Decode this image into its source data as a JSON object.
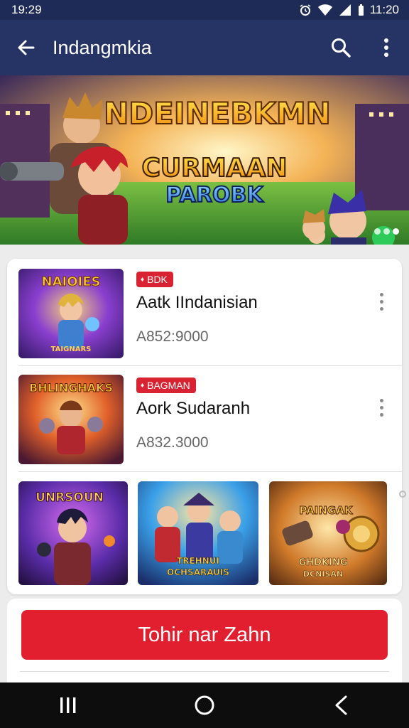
{
  "status_bar": {
    "time": "19:29",
    "clock_right": "11:20",
    "icons": [
      "alarm-icon",
      "wifi-icon",
      "signal-icon",
      "battery-icon"
    ]
  },
  "app_bar": {
    "title": "Indangmkia",
    "icons": [
      "back-arrow-icon",
      "search-icon",
      "more-vert-icon"
    ]
  },
  "banner": {
    "headline": "NDEINEBKMN",
    "sub_line1": "CURMAAN",
    "sub_line2": "PAROBK",
    "page_indicator": {
      "count": 3,
      "active": 2
    }
  },
  "products": [
    {
      "tag": "BDK",
      "name": "Aatk IIndanisian",
      "price": "A852:9000",
      "thumb_caption_top": "NAIOIES",
      "thumb_caption_bottom": "TAIGNARS"
    },
    {
      "tag": "BAGMAN",
      "name": "Aork Sudaranh",
      "price": "A832.3000",
      "thumb_caption_top": "BHLINGHAKS",
      "thumb_caption_bottom": ""
    }
  ],
  "tiles": [
    {
      "caption_top": "UNRSOUN",
      "caption_bottom": ""
    },
    {
      "caption_top": "",
      "caption_bottom_line1": "TREHNUI",
      "caption_bottom_line2": "OCHSARAUIS"
    },
    {
      "caption_top": "PAINGAK",
      "caption_bottom_line1": "GHDKING",
      "caption_bottom_line2": "DCNISAN"
    }
  ],
  "cta": {
    "label": "Tohir nar Zahn"
  },
  "colors": {
    "app_bar": "#253464",
    "status_bar": "#1f2b57",
    "accent_red": "#e21f2f",
    "nav_bar": "#0d0d0d"
  },
  "nav_bar": {
    "icons": [
      "recents-icon",
      "home-icon",
      "back-icon"
    ]
  }
}
